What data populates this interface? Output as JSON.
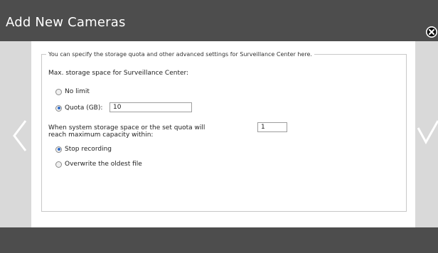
{
  "dialog": {
    "title": "Add New Cameras",
    "close_icon": "close-circle-icon",
    "prev_icon": "chevron-left-icon",
    "next_icon": "checkmark-icon"
  },
  "panel": {
    "legend": "You can specify the storage quota and other advanced settings for Surveillance Center here.",
    "max_storage_label": "Max. storage space for Surveillance Center:",
    "storage_options": [
      {
        "label": "No limit",
        "checked": false
      },
      {
        "label": "Quota (GB):",
        "checked": true
      }
    ],
    "quota_value": "10",
    "capacity_label_line1": "When system storage space or the set quota will",
    "capacity_label_line2": "reach maximum capacity within:",
    "capacity_value": "1",
    "action_options": [
      {
        "label": "Stop recording",
        "checked": true
      },
      {
        "label": "Overwrite the oldest file",
        "checked": false
      }
    ]
  },
  "colors": {
    "titlebar": "#4d4d4d",
    "side_panel": "#d9d9d9",
    "radio_selected": "#2f6bc8"
  }
}
